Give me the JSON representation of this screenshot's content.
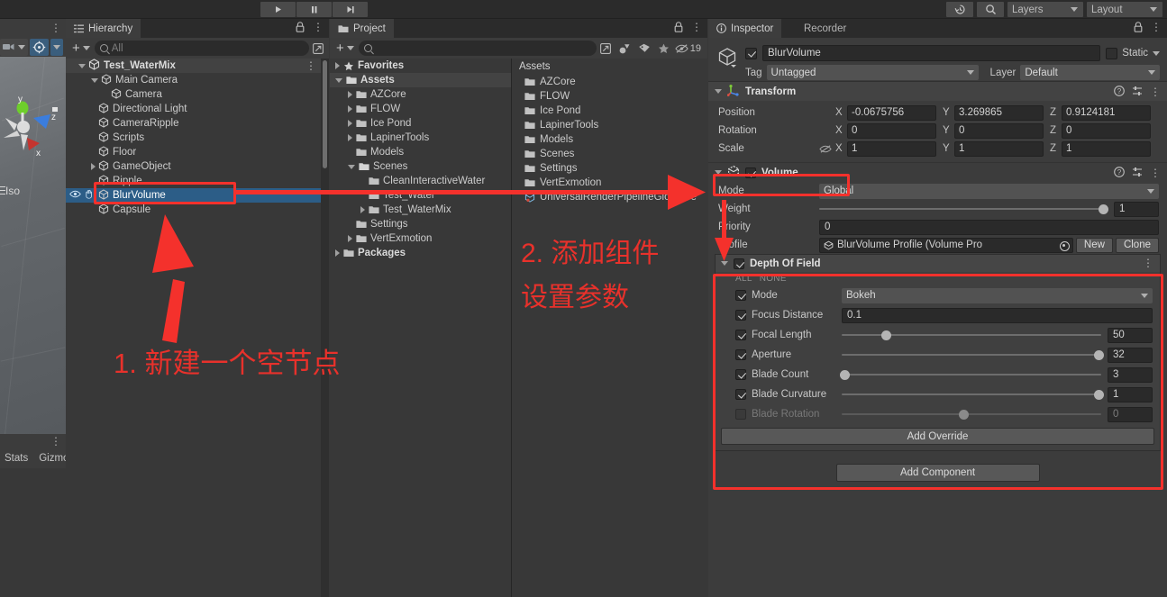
{
  "topbar": {
    "play_icon": "play-icon",
    "pause_icon": "pause-icon",
    "step_icon": "step-icon",
    "history_icon": "history-icon",
    "search_icon": "search-icon",
    "layers_label": "Layers",
    "layout_label": "Layout"
  },
  "scene": {
    "iso_label": "Iso",
    "stats_label": "Stats",
    "gizmos_label": "Gizmo",
    "axis_x": "x",
    "axis_y": "y",
    "axis_z": "z"
  },
  "hierarchy": {
    "tab_label": "Hierarchy",
    "search_placeholder": "All",
    "items": [
      {
        "label": "Test_WaterMix",
        "depth": 0,
        "arrow": "open",
        "type": "scene",
        "selected": false
      },
      {
        "label": "Main Camera",
        "depth": 1,
        "arrow": "open",
        "type": "go",
        "selected": false
      },
      {
        "label": "Camera",
        "depth": 2,
        "arrow": "none",
        "type": "go",
        "selected": false
      },
      {
        "label": "Directional Light",
        "depth": 1,
        "arrow": "none",
        "type": "go",
        "selected": false
      },
      {
        "label": "CameraRipple",
        "depth": 1,
        "arrow": "none",
        "type": "go",
        "selected": false
      },
      {
        "label": "Scripts",
        "depth": 1,
        "arrow": "none",
        "type": "go",
        "selected": false
      },
      {
        "label": "Floor",
        "depth": 1,
        "arrow": "none",
        "type": "go",
        "selected": false
      },
      {
        "label": "GameObject",
        "depth": 1,
        "arrow": "closed",
        "type": "go",
        "selected": false
      },
      {
        "label": "Ripple",
        "depth": 1,
        "arrow": "none",
        "type": "go",
        "selected": false
      },
      {
        "label": "BlurVolume",
        "depth": 1,
        "arrow": "none",
        "type": "go",
        "selected": true
      },
      {
        "label": "Capsule",
        "depth": 1,
        "arrow": "none",
        "type": "go",
        "selected": false
      }
    ]
  },
  "project": {
    "tab_label": "Project",
    "search_placeholder": "",
    "hidden_count": "19",
    "tree": [
      {
        "label": "Favorites",
        "depth": 0,
        "arrow": "closed",
        "icon": "star-icon",
        "highlight": false
      },
      {
        "label": "Assets",
        "depth": 0,
        "arrow": "open",
        "icon": "folder-open-icon",
        "highlight": true
      },
      {
        "label": "AZCore",
        "depth": 1,
        "arrow": "closed",
        "icon": "folder-icon",
        "highlight": false
      },
      {
        "label": "FLOW",
        "depth": 1,
        "arrow": "closed",
        "icon": "folder-icon",
        "highlight": false
      },
      {
        "label": "Ice Pond",
        "depth": 1,
        "arrow": "closed",
        "icon": "folder-icon",
        "highlight": false
      },
      {
        "label": "LapinerTools",
        "depth": 1,
        "arrow": "closed",
        "icon": "folder-icon",
        "highlight": false
      },
      {
        "label": "Models",
        "depth": 1,
        "arrow": "none",
        "icon": "folder-icon",
        "highlight": false
      },
      {
        "label": "Scenes",
        "depth": 1,
        "arrow": "open",
        "icon": "folder-open-icon",
        "highlight": false
      },
      {
        "label": "CleanInteractiveWater",
        "depth": 2,
        "arrow": "none",
        "icon": "folder-icon",
        "highlight": false
      },
      {
        "label": "Test_Water",
        "depth": 2,
        "arrow": "none",
        "icon": "folder-icon",
        "highlight": false
      },
      {
        "label": "Test_WaterMix",
        "depth": 2,
        "arrow": "closed",
        "icon": "folder-icon",
        "highlight": false
      },
      {
        "label": "Settings",
        "depth": 1,
        "arrow": "none",
        "icon": "folder-icon",
        "highlight": false
      },
      {
        "label": "VertExmotion",
        "depth": 1,
        "arrow": "closed",
        "icon": "folder-icon",
        "highlight": false
      },
      {
        "label": "Packages",
        "depth": 0,
        "arrow": "closed",
        "icon": "folder-icon",
        "highlight": false
      }
    ],
    "assets_header": "Assets",
    "assets": [
      {
        "label": "AZCore",
        "icon": "folder-icon"
      },
      {
        "label": "FLOW",
        "icon": "folder-icon"
      },
      {
        "label": "Ice Pond",
        "icon": "folder-icon"
      },
      {
        "label": "LapinerTools",
        "icon": "folder-icon"
      },
      {
        "label": "Models",
        "icon": "folder-icon"
      },
      {
        "label": "Scenes",
        "icon": "folder-icon"
      },
      {
        "label": "Settings",
        "icon": "folder-icon"
      },
      {
        "label": "VertExmotion",
        "icon": "folder-icon"
      },
      {
        "label": "UniversalRenderPipelineGlobalSe",
        "icon": "asset-icon"
      }
    ]
  },
  "inspector": {
    "tab_label": "Inspector",
    "recorder_tab_label": "Recorder",
    "object_name": "BlurVolume",
    "static_label": "Static",
    "tag_label": "Tag",
    "tag_value": "Untagged",
    "layer_label": "Layer",
    "layer_value": "Default",
    "transform": {
      "title": "Transform",
      "rows": [
        {
          "label": "Position",
          "x": "-0.0675756",
          "y": "3.269865",
          "z": "0.9124181",
          "lock": false
        },
        {
          "label": "Rotation",
          "x": "0",
          "y": "0",
          "z": "0",
          "lock": false
        },
        {
          "label": "Scale",
          "x": "1",
          "y": "1",
          "z": "1",
          "lock": true
        }
      ],
      "axis_labels": [
        "X",
        "Y",
        "Z"
      ]
    },
    "volume": {
      "title": "Volume",
      "mode_label": "Mode",
      "mode_value": "Global",
      "weight_label": "Weight",
      "weight_value": "1",
      "weight_fraction": 1.0,
      "priority_label": "Priority",
      "priority_value": "0",
      "profile_label": "Profile",
      "profile_value": "BlurVolume Profile (Volume Pro",
      "new_button": "New",
      "clone_button": "Clone"
    },
    "depth_of_field": {
      "title": "Depth Of Field",
      "all_label": "ALL",
      "none_label": "NONE",
      "rows": [
        {
          "label": "Mode",
          "checked": true,
          "kind": "dropdown",
          "value": "Bokeh"
        },
        {
          "label": "Focus Distance",
          "checked": true,
          "kind": "text",
          "value": "0.1"
        },
        {
          "label": "Focal Length",
          "checked": true,
          "kind": "slider",
          "value": "50",
          "fraction": 0.18
        },
        {
          "label": "Aperture",
          "checked": true,
          "kind": "slider",
          "value": "32",
          "fraction": 1.0
        },
        {
          "label": "Blade Count",
          "checked": true,
          "kind": "slider",
          "value": "3",
          "fraction": 0.02
        },
        {
          "label": "Blade Curvature",
          "checked": true,
          "kind": "slider",
          "value": "1",
          "fraction": 1.0
        },
        {
          "label": "Blade Rotation",
          "checked": false,
          "kind": "slider",
          "value": "0",
          "fraction": 0.48,
          "disabled": true
        }
      ]
    },
    "add_override_label": "Add Override",
    "add_component_label": "Add Component"
  },
  "annotations": {
    "step1": "1. 新建一个空节点",
    "step2_line1": "2. 添加组件",
    "step2_line2": "设置参数",
    "accent_color": "#f4312c"
  }
}
